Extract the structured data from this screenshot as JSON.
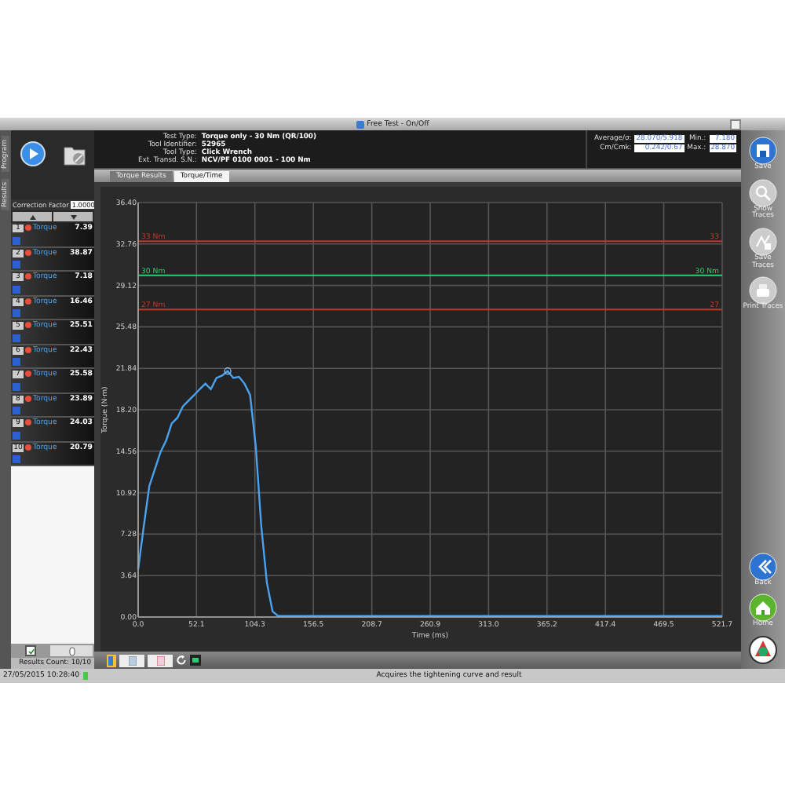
{
  "window": {
    "title": "Free Test - On/Off"
  },
  "left_panel": {
    "vertical_tabs": [
      "Program",
      "Results"
    ],
    "correction_factor": {
      "label": "Correction Factor",
      "value": "1.0000"
    },
    "results": [
      {
        "index": "1",
        "type": "Torque",
        "value": "7.39"
      },
      {
        "index": "2",
        "type": "Torque",
        "value": "38.87"
      },
      {
        "index": "3",
        "type": "Torque",
        "value": "7.18"
      },
      {
        "index": "4",
        "type": "Torque",
        "value": "16.46"
      },
      {
        "index": "5",
        "type": "Torque",
        "value": "25.51"
      },
      {
        "index": "6",
        "type": "Torque",
        "value": "22.43"
      },
      {
        "index": "7",
        "type": "Torque",
        "value": "25.58"
      },
      {
        "index": "8",
        "type": "Torque",
        "value": "23.89"
      },
      {
        "index": "9",
        "type": "Torque",
        "value": "24.03"
      },
      {
        "index": "10",
        "type": "Torque",
        "value": "20.79"
      }
    ],
    "accept_checked": true,
    "results_count": "Results Count: 10/10"
  },
  "test_info": {
    "fields": [
      {
        "label": "Test Type:",
        "value": "Torque only - 30 Nm (QR/100)"
      },
      {
        "label": "Tool Identifier:",
        "value": "52965"
      },
      {
        "label": "Tool Type:",
        "value": "Click Wrench"
      },
      {
        "label": "Ext. Transd. S.N.:",
        "value": "NCV/PF 0100 0001 - 100 Nm"
      }
    ],
    "stats": [
      {
        "label": "Average/σ:",
        "value": "28.070/5.918"
      },
      {
        "label": "Min.:",
        "value": "7.180"
      },
      {
        "label": "Cm/Cmk:",
        "value": "0.242/0.67"
      },
      {
        "label": "Max.:",
        "value": "28.870"
      }
    ]
  },
  "tabs": [
    {
      "label": "Torque Results",
      "selected": false
    },
    {
      "label": "Torque/Time",
      "selected": true
    }
  ],
  "chart_data": {
    "type": "line",
    "xlabel": "Time (ms)",
    "ylabel": "Torque (N·m)",
    "xlim": [
      0,
      521.7
    ],
    "ylim": [
      0,
      36.4
    ],
    "grid": true,
    "xticks": [
      {
        "value": 0,
        "label": "0.0"
      },
      {
        "value": 52.1,
        "label": "52.1"
      },
      {
        "value": 104.3,
        "label": "104.3"
      },
      {
        "value": 156.5,
        "label": "156.5"
      },
      {
        "value": 208.7,
        "label": "208.7"
      },
      {
        "value": 260.9,
        "label": "260.9"
      },
      {
        "value": 313,
        "label": "313.0"
      },
      {
        "value": 365.2,
        "label": "365.2"
      },
      {
        "value": 417.4,
        "label": "417.4"
      },
      {
        "value": 469.5,
        "label": "469.5"
      },
      {
        "value": 521.7,
        "label": "521.7"
      }
    ],
    "yticks": [
      {
        "value": 0,
        "label": "0.00"
      },
      {
        "value": 3.64,
        "label": "3.64"
      },
      {
        "value": 7.28,
        "label": "7.28"
      },
      {
        "value": 10.92,
        "label": "10.92"
      },
      {
        "value": 14.56,
        "label": "14.56"
      },
      {
        "value": 18.2,
        "label": "18.20"
      },
      {
        "value": 21.84,
        "label": "21.84"
      },
      {
        "value": 25.48,
        "label": "25.48"
      },
      {
        "value": 29.12,
        "label": "29.12"
      },
      {
        "value": 32.76,
        "label": "32.76"
      },
      {
        "value": 36.4,
        "label": "36.40"
      }
    ],
    "x": [
      0,
      5,
      10,
      15,
      20,
      25,
      30,
      35,
      40,
      45,
      50,
      55,
      60,
      65,
      70,
      75,
      80,
      85,
      90,
      95,
      100,
      105,
      110,
      115,
      120,
      125,
      200,
      300,
      400,
      521.7
    ],
    "series": [
      {
        "color": "#4aa3f0",
        "values": [
          4.2,
          8,
          11.5,
          13,
          14.5,
          15.5,
          17,
          17.5,
          18.5,
          19,
          19.5,
          20,
          20.5,
          20,
          21,
          21.2,
          21.6,
          21,
          21.1,
          20.5,
          19.5,
          15,
          8,
          3,
          0.5,
          0.1,
          0.1,
          0.1,
          0.1,
          0.1
        ]
      }
    ],
    "ref_lines": [
      {
        "axis": "y",
        "value": 33,
        "label": "33 Nm",
        "color": "#c0392b"
      },
      {
        "axis": "y",
        "value": 30,
        "label": "30 Nm",
        "color": "#2ecc71"
      },
      {
        "axis": "y",
        "value": 27,
        "label": "27 Nm",
        "color": "#c0392b"
      }
    ],
    "annotations": [
      {
        "text": "33",
        "y": 33
      },
      {
        "text": "30 Nm",
        "y": 30
      },
      {
        "text": "27",
        "y": 27
      }
    ]
  },
  "side_buttons": [
    {
      "kind": "save",
      "label": "Save"
    },
    {
      "kind": "zoom",
      "label": "Show Traces"
    },
    {
      "kind": "save_traces",
      "label": "Save Traces"
    },
    {
      "kind": "print",
      "label": "Print Traces"
    },
    {
      "kind": "back",
      "label": "Back"
    },
    {
      "kind": "home",
      "label": "Home"
    }
  ],
  "status_bar": {
    "datetime": "27/05/2015 10:28:40",
    "message": "Acquires the tightening curve and result"
  }
}
